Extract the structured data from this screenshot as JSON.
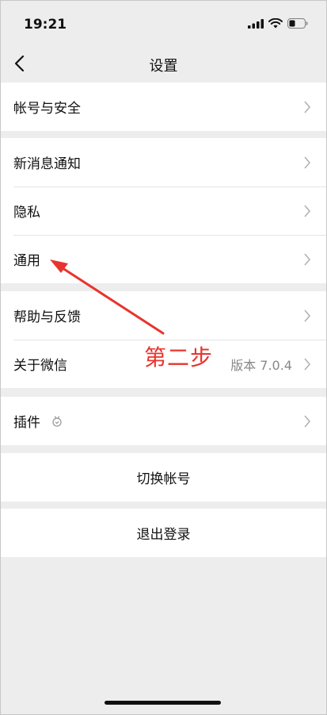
{
  "status_bar": {
    "time": "19:21"
  },
  "nav": {
    "title": "设置"
  },
  "groups": {
    "account": {
      "label": "帐号与安全"
    },
    "messages": {
      "notifications": "新消息通知",
      "privacy": "隐私",
      "general": "通用"
    },
    "about": {
      "help": "帮助与反馈",
      "about_wechat": "关于微信",
      "version": "版本 7.0.4"
    },
    "plugins": {
      "label": "插件"
    },
    "switch_account": {
      "label": "切换帐号"
    },
    "logout": {
      "label": "退出登录"
    }
  },
  "annotation": {
    "text": "第二步",
    "color": "#e8342e"
  },
  "icons": [
    "signal-icon",
    "wifi-icon",
    "battery-icon",
    "back-arrow-icon",
    "chevron-right-icon",
    "plugin-icon"
  ]
}
